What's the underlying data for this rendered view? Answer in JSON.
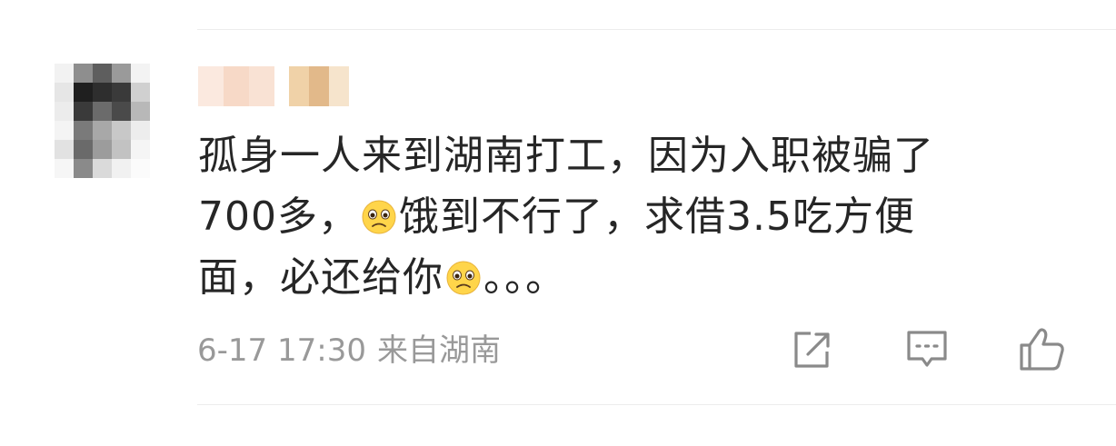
{
  "comment": {
    "line1": "孤身一人来到湖南打工，因为入职被骗了",
    "line2_a": "700多，",
    "line2_b": "饿到不行了，求借3.5吃方便",
    "line3_a": "面，必还给你",
    "line3_b": "。。。",
    "emoji_names": [
      "pleading-face-icon",
      "pleading-face-icon"
    ]
  },
  "meta": {
    "date_time": "6-17 17:30",
    "location": "来自湖南"
  },
  "actions": {
    "share_icon": "share-icon",
    "reply_icon": "comment-icon",
    "like_icon": "thumbs-up-icon"
  },
  "colors": {
    "text": "#262626",
    "meta": "#999999",
    "icon": "#8a8a8a",
    "divider": "#ececec"
  }
}
